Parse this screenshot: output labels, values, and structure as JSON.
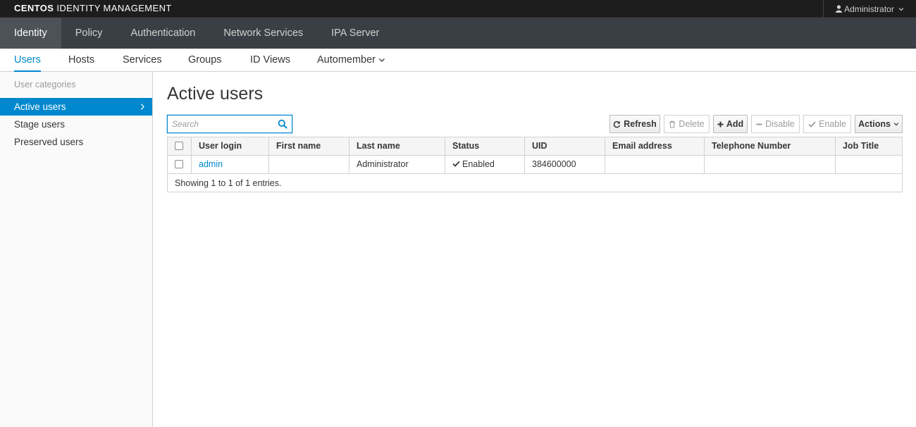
{
  "header": {
    "brand_bold": "CENTOS",
    "brand_rest": " IDENTITY MANAGEMENT",
    "user": "Administrator"
  },
  "primary_nav": [
    "Identity",
    "Policy",
    "Authentication",
    "Network Services",
    "IPA Server"
  ],
  "secondary_nav": [
    "Users",
    "Hosts",
    "Services",
    "Groups",
    "ID Views",
    "Automember"
  ],
  "sidebar": {
    "category": "User categories",
    "items": [
      "Active users",
      "Stage users",
      "Preserved users"
    ]
  },
  "main": {
    "title": "Active users",
    "search_placeholder": "Search",
    "buttons": {
      "refresh": "Refresh",
      "delete": "Delete",
      "add": "Add",
      "disable": "Disable",
      "enable": "Enable",
      "actions": "Actions"
    },
    "columns": [
      "User login",
      "First name",
      "Last name",
      "Status",
      "UID",
      "Email address",
      "Telephone Number",
      "Job Title"
    ],
    "rows": [
      {
        "login": "admin",
        "first_name": "",
        "last_name": "Administrator",
        "status": "Enabled",
        "uid": "384600000",
        "email": "",
        "phone": "",
        "job_title": ""
      }
    ],
    "footer": "Showing 1 to 1 of 1 entries."
  },
  "colors": {
    "accent": "#0088ce",
    "topbar": "#1d1d1d",
    "primary_nav": "#393f44",
    "primary_nav_active": "#4d5258"
  },
  "icons": {
    "user": "user-icon",
    "search": "search-icon",
    "refresh": "refresh-icon",
    "delete": "trash-icon",
    "add": "plus-icon",
    "disable": "minus-icon",
    "enable": "check-icon",
    "status_enabled": "check-icon"
  }
}
